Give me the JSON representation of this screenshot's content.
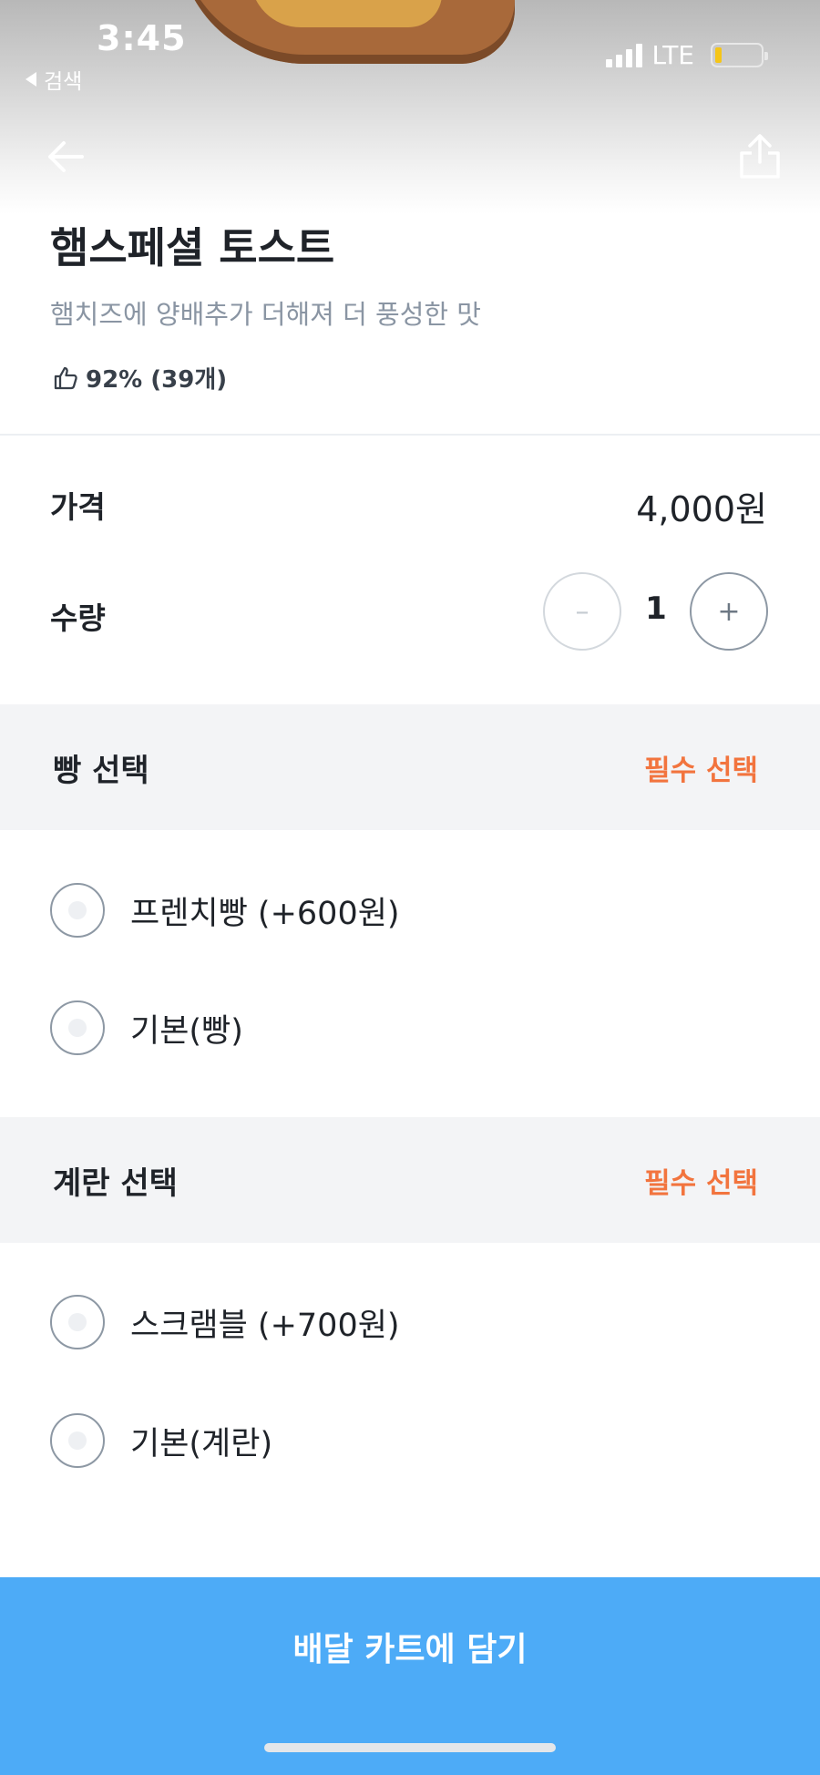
{
  "status_bar": {
    "time": "3:45",
    "back_label": "검색",
    "network": "LTE",
    "battery_color": "#f5c518"
  },
  "nav": {
    "back_icon": "arrow-left-icon",
    "share_icon": "share-icon"
  },
  "product": {
    "title": "햄스페셜 토스트",
    "description": "햄치즈에 양배추가 더해져 더 풍성한 맛",
    "likes_text": "92% (39개)",
    "like_icon": "thumbs-up-icon"
  },
  "price": {
    "label": "가격",
    "value": "4,000원"
  },
  "quantity": {
    "label": "수량",
    "minus": "–",
    "value": "1",
    "plus": "+"
  },
  "sections": [
    {
      "title": "빵 선택",
      "required": "필수 선택",
      "options": [
        {
          "label": "프렌치빵 (+600원)"
        },
        {
          "label": "기본(빵)"
        }
      ]
    },
    {
      "title": "계란 선택",
      "required": "필수 선택",
      "options": [
        {
          "label": "스크램블 (+700원)"
        },
        {
          "label": "기본(계란)"
        }
      ]
    }
  ],
  "cart_button": {
    "label": "배달 카트에 담기",
    "color": "#4dabf7"
  },
  "colors": {
    "accent_required": "#f2743e",
    "text_primary": "#1f2329",
    "text_secondary": "#8a95a3"
  }
}
